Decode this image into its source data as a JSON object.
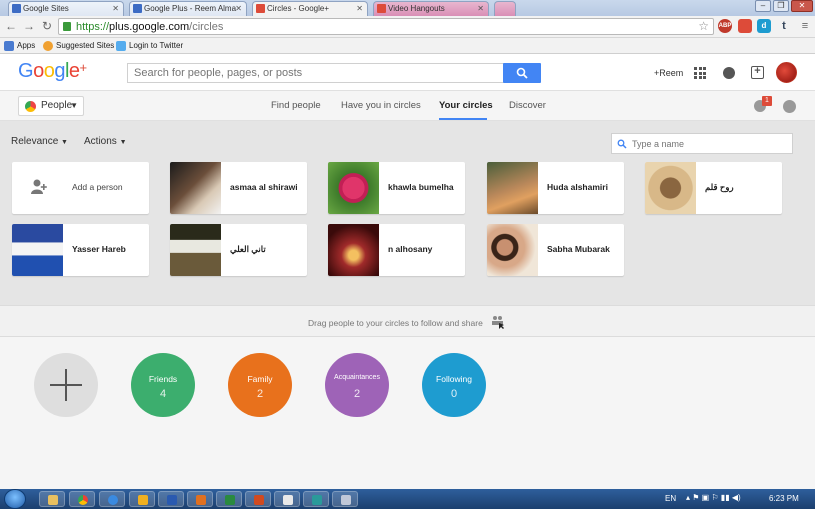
{
  "browser": {
    "tabs": [
      {
        "title": "Google Sites",
        "color": "#3c6bc4"
      },
      {
        "title": "Google Plus - Reem Alma",
        "color": "#3c6bc4"
      },
      {
        "title": "Circles - Google+",
        "color": "#dd4b39"
      },
      {
        "title": "Video Hangouts",
        "color": "#dd4b39"
      }
    ],
    "url_protocol": "https://",
    "url_host": "plus.google.com",
    "url_path": "/circles",
    "bookmarks": [
      "Apps",
      "Suggested Sites",
      "Login to Twitter"
    ],
    "extensions": [
      "ABP",
      "d",
      "t"
    ]
  },
  "header": {
    "logo": "Google+",
    "search_placeholder": "Search for people, pages, or posts",
    "user_link": "+Reem"
  },
  "subnav": {
    "people_label": "People",
    "tabs": [
      "Find people",
      "Have you in circles",
      "Your circles",
      "Discover"
    ],
    "active_tab": "Your circles",
    "notification_count": "1"
  },
  "controls": {
    "relevance_label": "Relevance",
    "actions_label": "Actions",
    "type_name_placeholder": "Type a name"
  },
  "people": {
    "add_person_label": "Add a person",
    "cards": [
      {
        "name": "asmaa al shirawi"
      },
      {
        "name": "khawla bumelha"
      },
      {
        "name": "Huda alshamiri"
      },
      {
        "name": "روح قلم"
      },
      {
        "name": "Yasser Hareb"
      },
      {
        "name": "تاني العلي"
      },
      {
        "name": "n alhosany"
      },
      {
        "name": "Sabha Mubarak"
      }
    ]
  },
  "drag_hint": "Drag people to your circles to follow and share",
  "circles": [
    {
      "name": "Friends",
      "count": "4",
      "color": "#3cae6e"
    },
    {
      "name": "Family",
      "count": "2",
      "color": "#e8711c"
    },
    {
      "name": "Acquaintances",
      "count": "2",
      "color": "#9e63b7"
    },
    {
      "name": "Following",
      "count": "0",
      "color": "#1e9cd0"
    }
  ],
  "taskbar": {
    "language": "EN",
    "time": "6:23 PM"
  }
}
